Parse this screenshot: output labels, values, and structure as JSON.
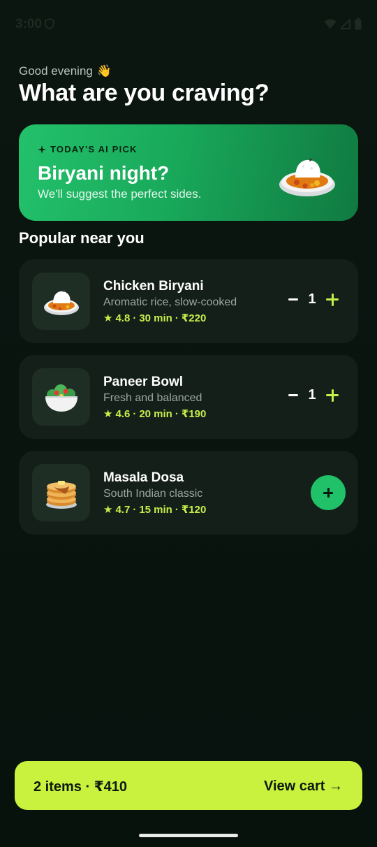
{
  "status_bar": {
    "time": "3:00",
    "icons": [
      "shield-icon",
      "wifi-icon",
      "signal-icon",
      "battery-icon"
    ]
  },
  "greeting": {
    "subtitle": "Good evening",
    "emoji": "👋",
    "title": "What are you craving?"
  },
  "ai_pick": {
    "kicker": "TODAY'S AI PICK",
    "title": "Biryani night?",
    "subtitle": "We'll suggest the perfect sides.",
    "icon": "curry-rice-icon",
    "colors": {
      "start": "#23c16b",
      "end": "#107a40"
    }
  },
  "section": {
    "title": "Popular near you"
  },
  "items": [
    {
      "name": "Chicken Biryani",
      "desc": "Aromatic rice, slow-cooked",
      "star": "★",
      "rating": "4.8",
      "sep1": "·",
      "time": "30 min",
      "sep2": "·",
      "price": "₹220",
      "qty": "1",
      "icon": "curry-rice-icon"
    },
    {
      "name": "Paneer Bowl",
      "desc": "Fresh and balanced",
      "star": "★",
      "rating": "4.6",
      "sep1": "·",
      "time": "20 min",
      "sep2": "·",
      "price": "₹190",
      "qty": "1",
      "icon": "salad-icon"
    },
    {
      "name": "Masala Dosa",
      "desc": "South Indian classic",
      "star": "★",
      "rating": "4.7",
      "sep1": "·",
      "time": "15 min",
      "sep2": "·",
      "price": "₹120",
      "icon": "pancakes-icon"
    }
  ],
  "cart": {
    "summary": "2 items · ₹410",
    "action": "View cart →"
  },
  "colors": {
    "background": "#0b1510",
    "card": "#141f19",
    "accent_lime": "#c8f23d",
    "accent_green": "#21c16a"
  }
}
